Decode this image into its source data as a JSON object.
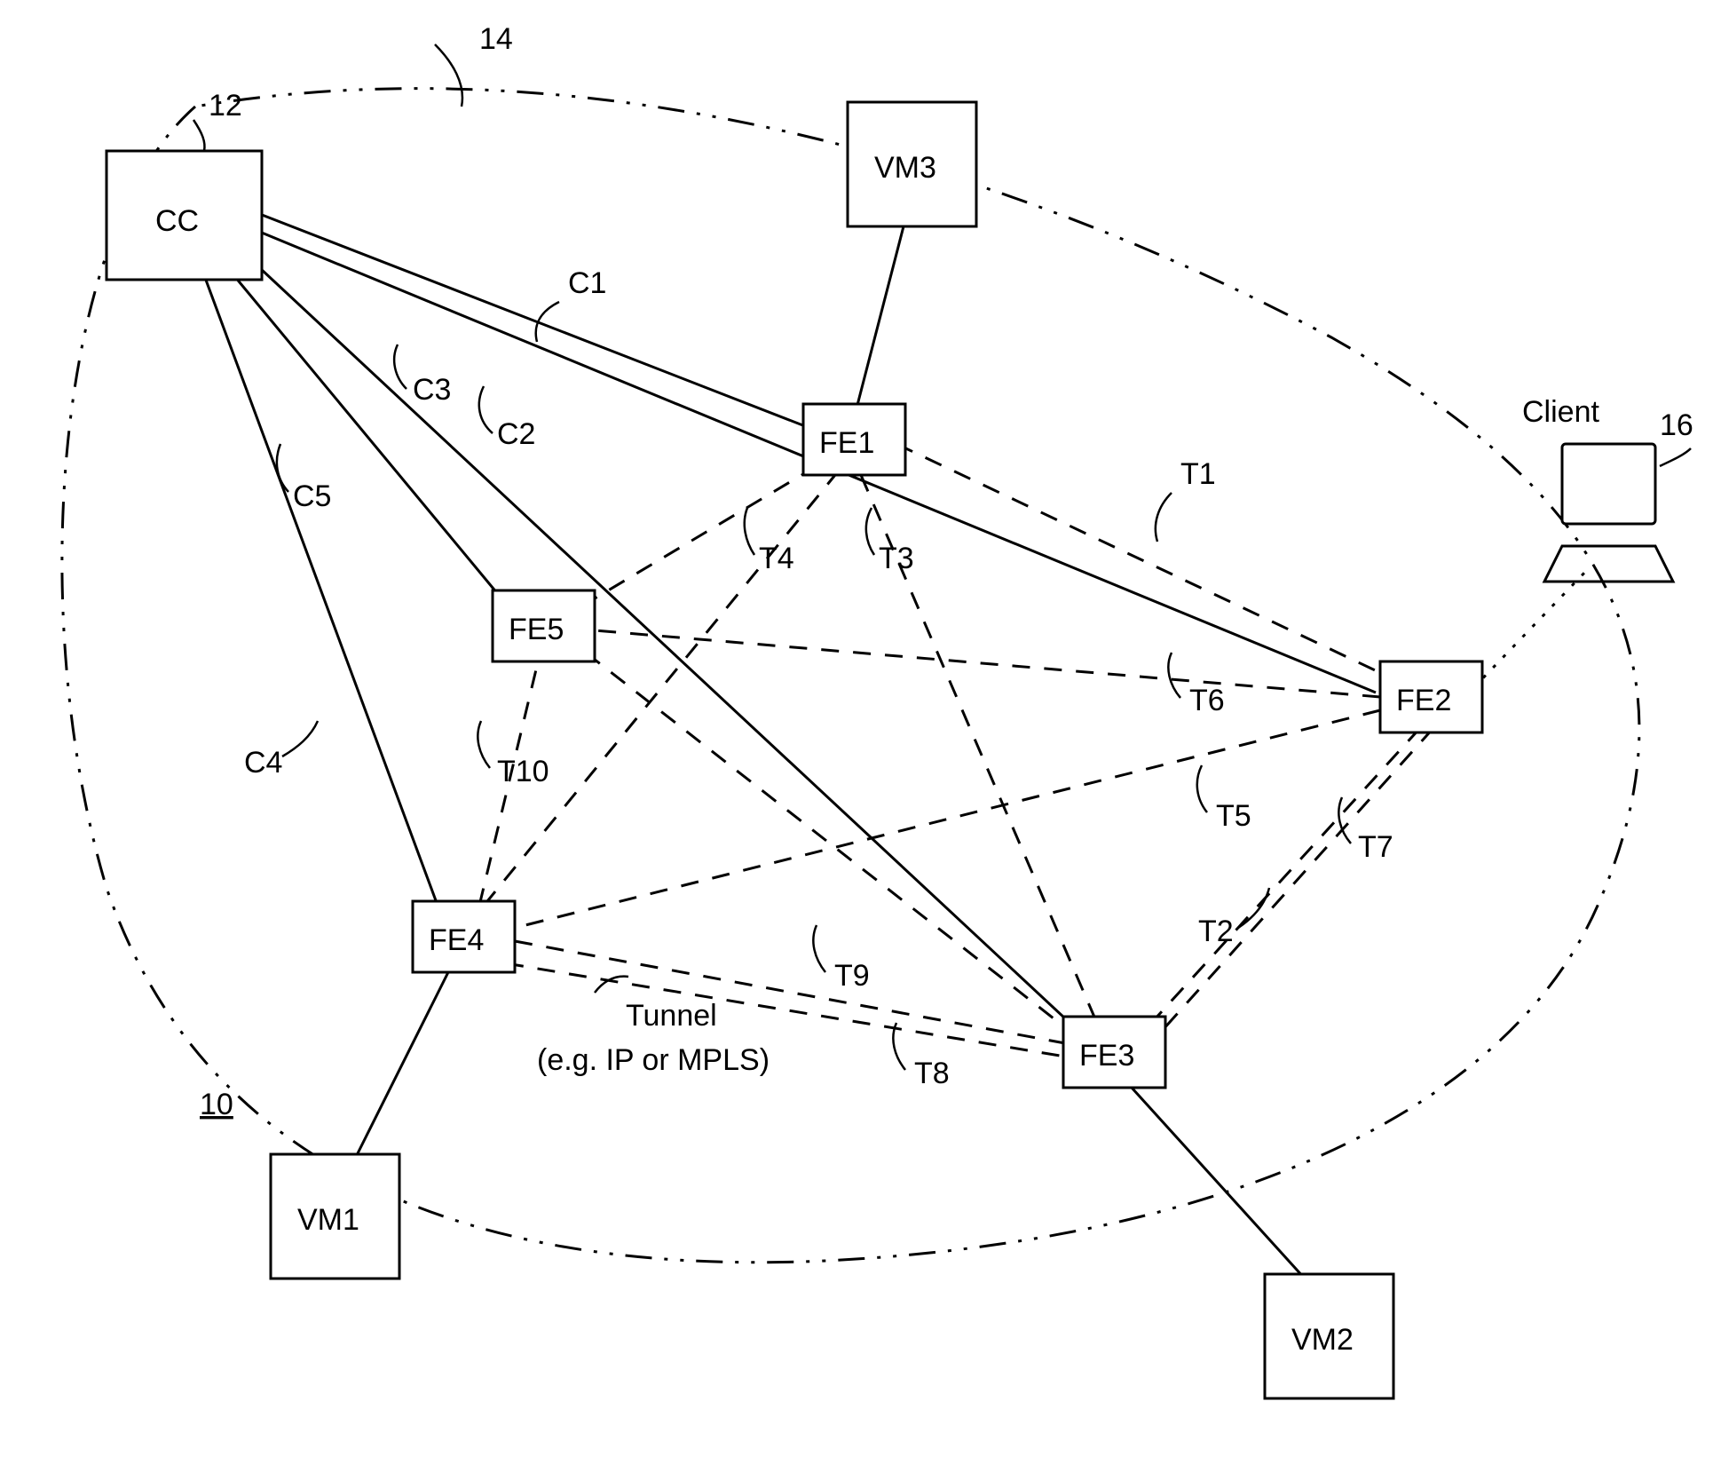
{
  "ref_system": "10",
  "ref_cc": "12",
  "ref_boundary": "14",
  "ref_client": "16",
  "nodes": {
    "CC": "CC",
    "FE1": "FE1",
    "FE2": "FE2",
    "FE3": "FE3",
    "FE4": "FE4",
    "FE5": "FE5",
    "VM1": "VM1",
    "VM2": "VM2",
    "VM3": "VM3"
  },
  "client_label": "Client",
  "tunnel_note": {
    "line1": "Tunnel",
    "line2": "(e.g. IP or MPLS)"
  },
  "control_links": {
    "C1": "C1",
    "C2": "C2",
    "C3": "C3",
    "C4": "C4",
    "C5": "C5"
  },
  "tunnels": {
    "T1": "T1",
    "T2": "T2",
    "T3": "T3",
    "T4": "T4",
    "T5": "T5",
    "T6": "T6",
    "T7": "T7",
    "T8": "T8",
    "T9": "T9",
    "T10": "T10"
  },
  "chart_data": {
    "type": "network-diagram",
    "nodes": [
      {
        "id": "CC",
        "type": "controller",
        "label": "CC",
        "ref": "12"
      },
      {
        "id": "FE1",
        "type": "forwarding-element",
        "label": "FE1"
      },
      {
        "id": "FE2",
        "type": "forwarding-element",
        "label": "FE2"
      },
      {
        "id": "FE3",
        "type": "forwarding-element",
        "label": "FE3"
      },
      {
        "id": "FE4",
        "type": "forwarding-element",
        "label": "FE4"
      },
      {
        "id": "FE5",
        "type": "forwarding-element",
        "label": "FE5"
      },
      {
        "id": "VM1",
        "type": "vm",
        "label": "VM1"
      },
      {
        "id": "VM2",
        "type": "vm",
        "label": "VM2"
      },
      {
        "id": "VM3",
        "type": "vm",
        "label": "VM3"
      },
      {
        "id": "Client",
        "type": "client",
        "label": "Client",
        "ref": "16"
      }
    ],
    "edges_control_solid": [
      {
        "id": "C1",
        "from": "CC",
        "to": "FE1"
      },
      {
        "id": "C2",
        "from": "CC",
        "to": "FE2"
      },
      {
        "id": "C3",
        "from": "CC",
        "to": "FE3"
      },
      {
        "id": "C4",
        "from": "CC",
        "to": "FE4"
      },
      {
        "id": "C5",
        "from": "CC",
        "to": "FE5"
      }
    ],
    "edges_tunnel_dashed": [
      {
        "id": "T1",
        "from": "FE1",
        "to": "FE2"
      },
      {
        "id": "T2",
        "from": "FE2",
        "to": "FE3"
      },
      {
        "id": "T3",
        "from": "FE1",
        "to": "FE3"
      },
      {
        "id": "T4",
        "from": "FE1",
        "to": "FE5"
      },
      {
        "id": "T5",
        "from": "FE2",
        "to": "FE4"
      },
      {
        "id": "T6",
        "from": "FE2",
        "to": "FE5"
      },
      {
        "id": "T7",
        "from": "FE3",
        "to": "FE2"
      },
      {
        "id": "T8",
        "from": "FE3",
        "to": "FE4"
      },
      {
        "id": "T9",
        "from": "FE4",
        "to": "FE3"
      },
      {
        "id": "T10",
        "from": "FE4",
        "to": "FE5"
      }
    ],
    "edges_attach_solid": [
      {
        "from": "FE1",
        "to": "VM3"
      },
      {
        "from": "FE3",
        "to": "VM2"
      },
      {
        "from": "FE4",
        "to": "VM1"
      }
    ],
    "edges_dotted": [
      {
        "from": "FE2",
        "to": "Client"
      }
    ],
    "boundary": {
      "ref": "14",
      "style": "dash-dot-dot",
      "encloses": [
        "CC",
        "FE1",
        "FE2",
        "FE3",
        "FE4",
        "FE5"
      ]
    },
    "system_ref": "10",
    "tunnel_note": "Tunnel (e.g. IP or MPLS)"
  }
}
